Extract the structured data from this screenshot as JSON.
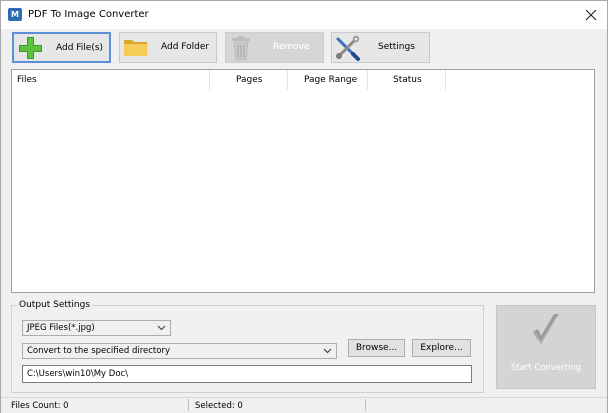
{
  "window": {
    "title": "PDF To Image Converter",
    "app_icon": "pdf-app-icon",
    "close_icon": "close-icon"
  },
  "toolbar": {
    "add_files": {
      "label": "Add File(s)",
      "icon": "add-icon"
    },
    "add_folder": {
      "label": "Add Folder",
      "icon": "folder-icon"
    },
    "remove": {
      "label": "Remove",
      "icon": "trash-icon",
      "enabled": false
    },
    "settings": {
      "label": "Settings",
      "icon": "wrench-screwdriver-icon"
    }
  },
  "file_list": {
    "columns": [
      "Files",
      "Pages",
      "Page Range",
      "Status"
    ],
    "rows": []
  },
  "output_settings": {
    "group_label": "Output Settings",
    "format": {
      "selected": "JPEG Files(*.jpg)"
    },
    "destination": {
      "selected": "Convert to the specified directory"
    },
    "browse_label": "Browse...",
    "explore_label": "Explore...",
    "path": "C:\\Users\\win10\\My Doc\\"
  },
  "start": {
    "label": "Start Converting",
    "icon": "checkmark-icon",
    "enabled": false
  },
  "status": {
    "files_count": "Files Count: 0",
    "selected": "Selected: 0"
  },
  "colors": {
    "primary_border": "#5b8fd6",
    "disabled_bg": "#d4d4d4",
    "app_icon_bg": "#2d6db5"
  }
}
